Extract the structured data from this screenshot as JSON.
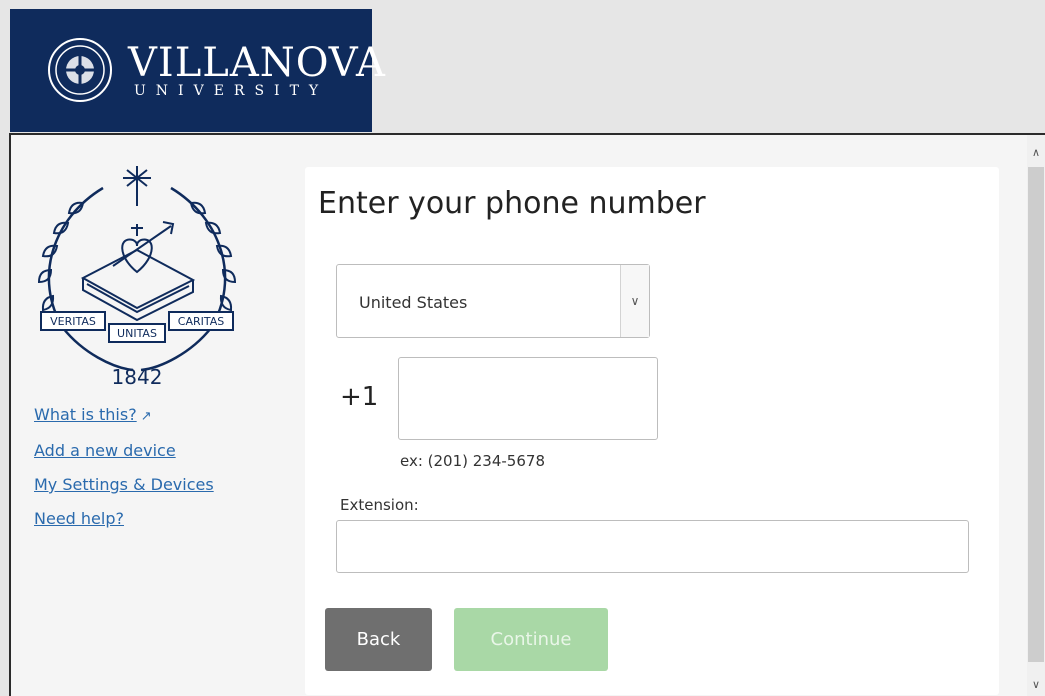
{
  "brand": {
    "name": "VILLANOVA",
    "subtitle": "UNIVERSITY",
    "header_bg": "#0f2b5c"
  },
  "seal": {
    "ribbon_left": "VERITAS",
    "ribbon_center": "UNITAS",
    "ribbon_right": "CARITAS",
    "year": "1842"
  },
  "sidebar": {
    "links": [
      {
        "label": "What is this?",
        "icon": "external-link-icon"
      },
      {
        "label": "Add a new device"
      },
      {
        "label": "My Settings & Devices"
      },
      {
        "label": "Need help?"
      }
    ],
    "link_color": "#2a6aad"
  },
  "form": {
    "title": "Enter your phone number",
    "country": {
      "selected": "United States"
    },
    "phone": {
      "prefix": "+1",
      "value": "",
      "example": "ex: (201) 234-5678"
    },
    "extension": {
      "label": "Extension:",
      "value": ""
    },
    "buttons": {
      "back": "Back",
      "continue": "Continue"
    }
  },
  "colors": {
    "back_button": "#6f6f6f",
    "continue_button": "#a9d8a6"
  }
}
